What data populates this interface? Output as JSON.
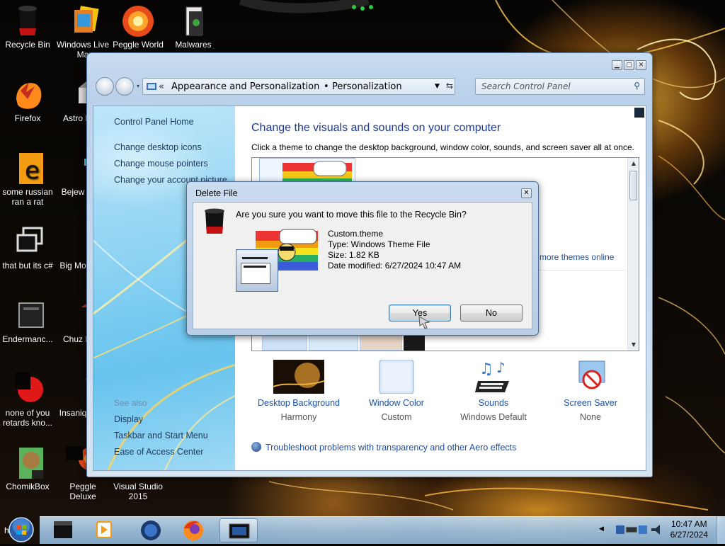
{
  "desktop": {
    "icons": [
      {
        "label": "Recycle Bin",
        "icon": "recycle-bin-icon"
      },
      {
        "label": "Windows Live Ma",
        "icon": "windows-live-icon"
      },
      {
        "label": "Peggle World",
        "icon": "peggle-icon"
      },
      {
        "label": "Malwares",
        "icon": "folder-icon"
      },
      {
        "label": "Firefox",
        "icon": "firefox-icon"
      },
      {
        "label": "Astro Delu",
        "icon": "game-icon"
      },
      {
        "label": "some russian ran a rat",
        "icon": "document-icon"
      },
      {
        "label": "Bejew Delu",
        "icon": "game-icon"
      },
      {
        "label": "that but its c#",
        "icon": "shortcut-icon"
      },
      {
        "label": "Big Mo Delu",
        "icon": "game-icon"
      },
      {
        "label": "Endermanc...",
        "icon": "app-icon"
      },
      {
        "label": "Chuz Delu",
        "icon": "game-icon"
      },
      {
        "label": "none of you retards kno...",
        "icon": "app-icon"
      },
      {
        "label": "Insaniq Delu",
        "icon": "game-icon"
      },
      {
        "label": "ChomikBox",
        "icon": "chomikbox-icon"
      },
      {
        "label": "Peggle Deluxe",
        "icon": "peggle-icon"
      },
      {
        "label": "Visual Studio 2015",
        "icon": "visual-studio-icon"
      },
      {
        "label": "ha...a.a",
        "icon": "app-icon"
      }
    ]
  },
  "window": {
    "breadcrumb": {
      "prefix": "«",
      "item1": "Appearance and Personalization",
      "separator": "•",
      "item2": "Personalization"
    },
    "search_placeholder": "Search Control Panel",
    "sidebar": {
      "home": "Control Panel Home",
      "links": [
        "Change desktop icons",
        "Change mouse pointers",
        "Change your account picture"
      ],
      "see_also": "See also",
      "see_also_links": [
        "Display",
        "Taskbar and Start Menu",
        "Ease of Access Center"
      ]
    },
    "main": {
      "title": "Change the visuals and sounds on your computer",
      "subtitle": "Click a theme to change the desktop background, window color, sounds, and screen saver all at once.",
      "more_themes": "more themes online",
      "bottom": [
        {
          "title": "Desktop Background",
          "sub": "Harmony",
          "icon": "desktop-background-icon"
        },
        {
          "title": "Window Color",
          "sub": "Custom",
          "icon": "window-color-icon"
        },
        {
          "title": "Sounds",
          "sub": "Windows Default",
          "icon": "sounds-icon"
        },
        {
          "title": "Screen Saver",
          "sub": "None",
          "icon": "screen-saver-icon"
        }
      ],
      "troubleshoot": "Troubleshoot problems with transparency and other Aero effects"
    }
  },
  "dialog": {
    "title": "Delete File",
    "close": "✕",
    "question": "Are you sure you want to move this file to the Recycle Bin?",
    "file_name": "Custom.theme",
    "file_type": "Type: Windows Theme File",
    "file_size": "Size: 1.82 KB",
    "file_date": "Date modified: 6/27/2024 10:47 AM",
    "yes": "Yes",
    "no": "No"
  },
  "taskbar": {
    "time": "10:47 AM",
    "date": "6/27/2024"
  },
  "colors": {
    "link": "#1e50a2",
    "title": "#1e3a8c",
    "taskbar": "#a0c3e1"
  }
}
